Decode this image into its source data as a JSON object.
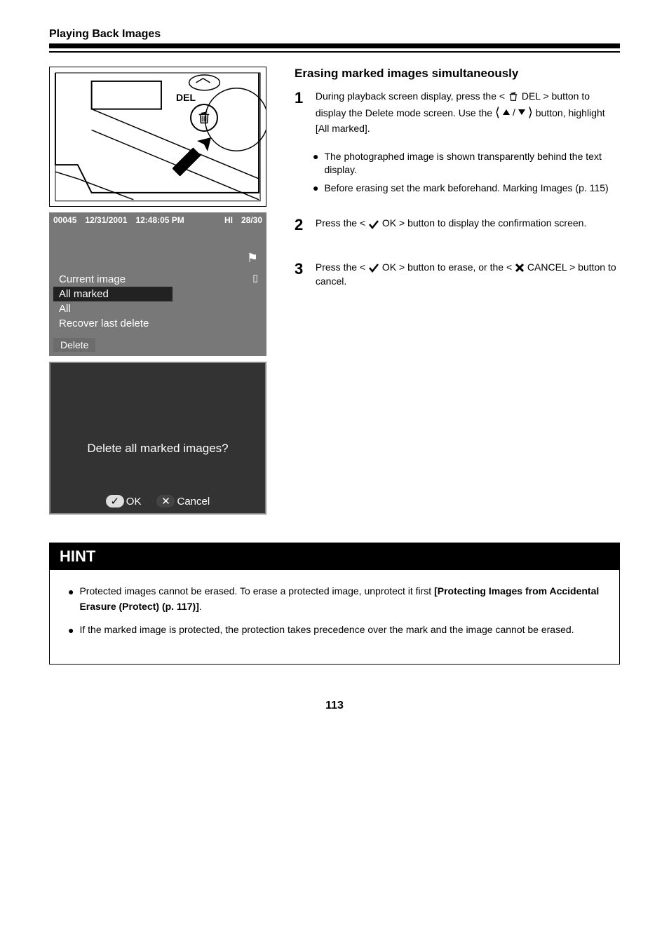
{
  "header": {
    "chapter": "Playing Back Images"
  },
  "section": {
    "title": "Erasing marked images simultaneously"
  },
  "illustration": {
    "del_label": "DEL"
  },
  "photo_screen": {
    "file_no": "00045",
    "date": "12/31/2001",
    "time": "12:48:05 PM",
    "quality": "HI",
    "count": "28/30",
    "menu": {
      "item1": "Current image",
      "item2": "All marked",
      "item3": "All",
      "item4": "Recover last delete"
    },
    "label": "Delete"
  },
  "confirm": {
    "text": "Delete all marked images?",
    "ok": "OK",
    "cancel": "Cancel"
  },
  "steps": {
    "s1": {
      "num": "1",
      "txt1": "During playback screen display, press the ",
      "del_word": "DEL",
      "txt2": " > button to display the Delete mode screen. Use the ",
      "txt3": " button, highlight [All marked]."
    },
    "bul1": "The photographed image is shown transparently behind the text display.",
    "bul2": "Before erasing set the mark beforehand.",
    "bul2_link": "Marking Images (p. 115)",
    "s2": {
      "num": "2",
      "txt1": "Press the ",
      "ok": "OK",
      "txt2": " > button to display the confirmation screen."
    },
    "s3": {
      "num": "3",
      "txt1": "Press the ",
      "ok": "OK",
      "txt2": " > button to erase, or the ",
      "cancel": "CANCEL",
      "txt3": " > button to cancel."
    }
  },
  "hint": {
    "title": "HINT",
    "b1_1": "Protected images cannot be erased. To erase a protected image, unprotect it first",
    "b1_link": "[Protecting Images from Accidental Erasure (Protect) (p. 117)]",
    "b2": "If the marked image is protected, the protection takes precedence over the mark and the image cannot be erased."
  },
  "page_number": "113"
}
